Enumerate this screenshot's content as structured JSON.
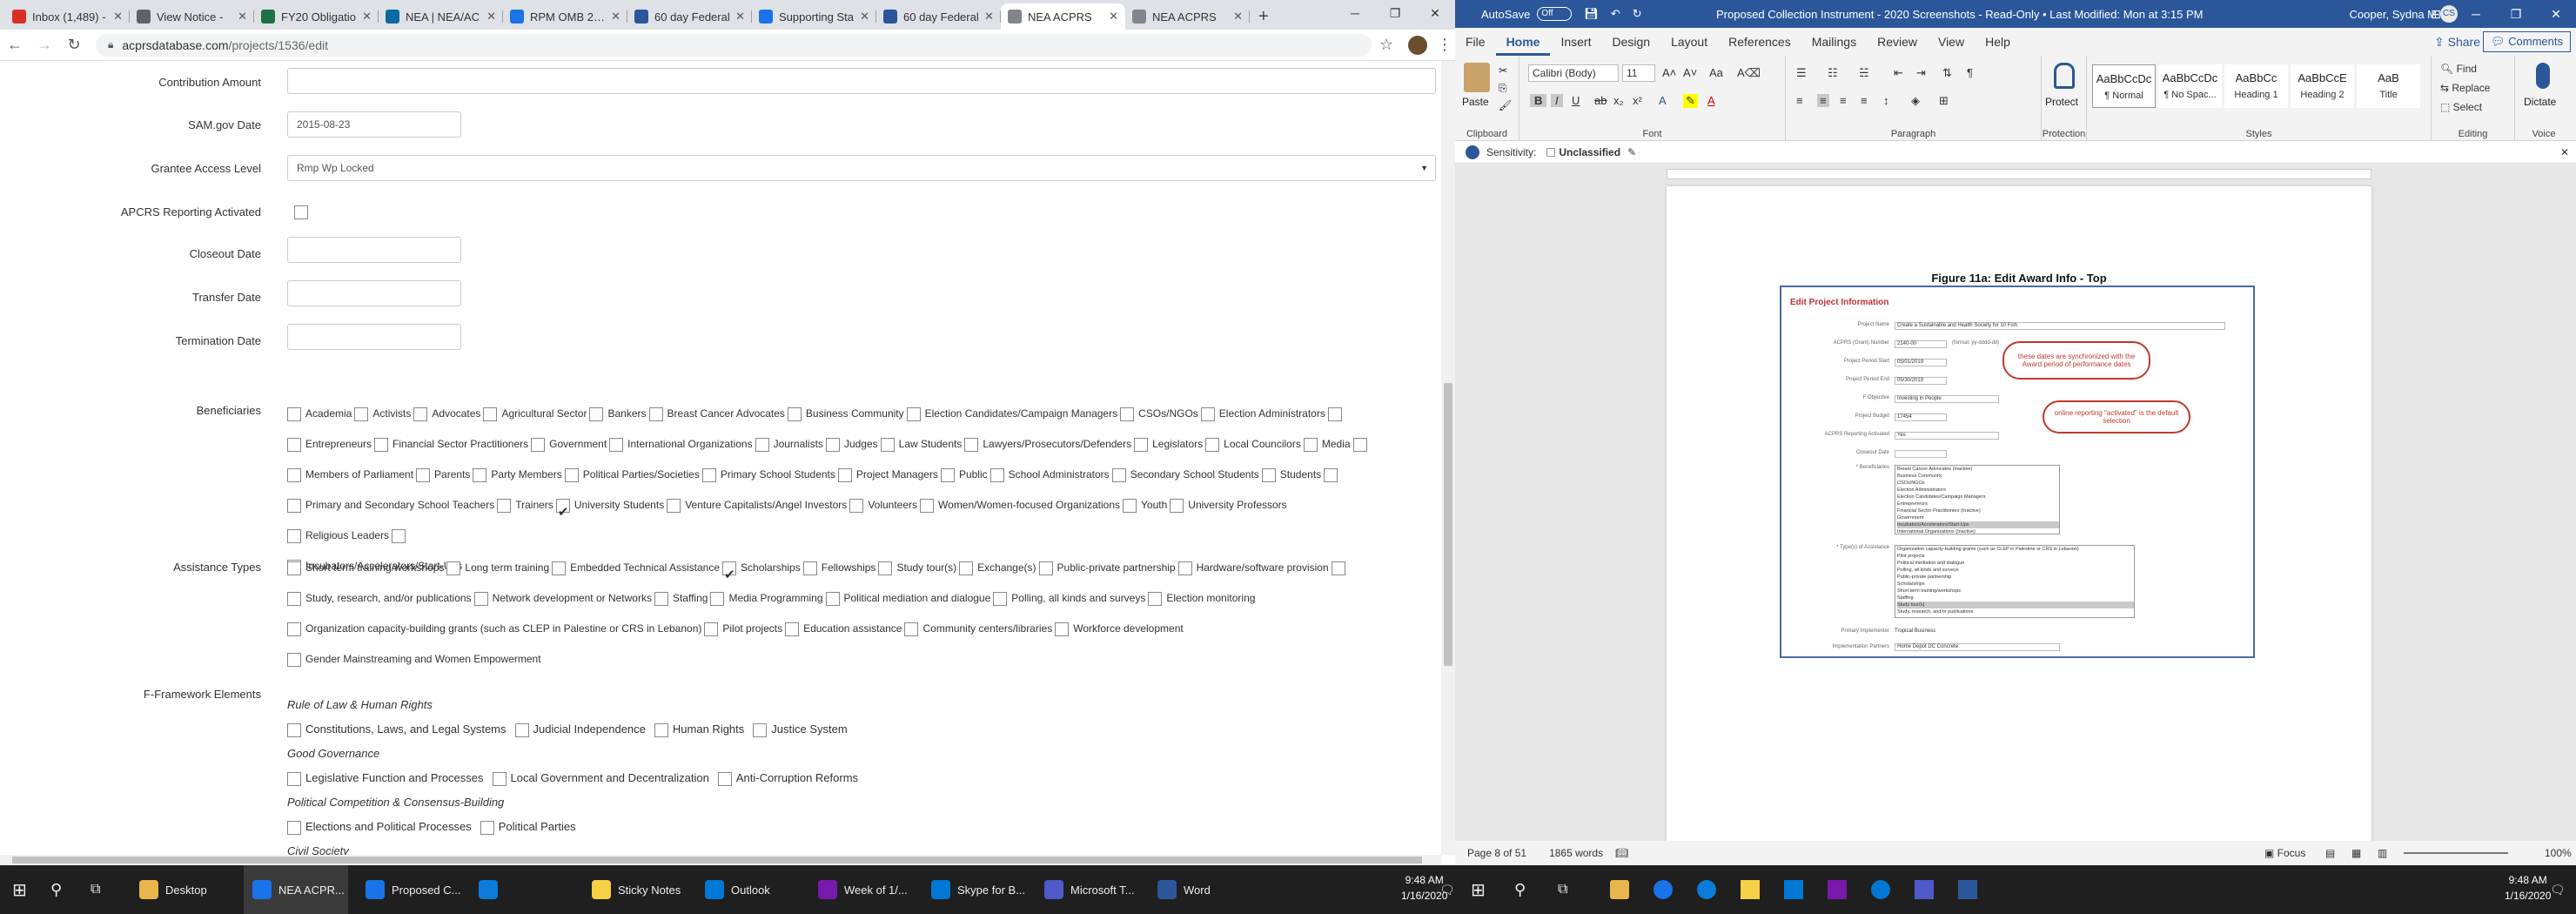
{
  "browser": {
    "tabs": [
      {
        "label": "Inbox (1,489) -",
        "color": "#d93025"
      },
      {
        "label": "View Notice -",
        "color": "#5f6368"
      },
      {
        "label": "FY20 Obligatio",
        "color": "#1e7145"
      },
      {
        "label": "NEA | NEA/AC",
        "color": "#0b6aa2"
      },
      {
        "label": "RPM OMB 2020",
        "color": "#1a73e8"
      },
      {
        "label": "60 day Federal",
        "color": "#2b579a"
      },
      {
        "label": "Supporting Sta",
        "color": "#1a73e8"
      },
      {
        "label": "60 day Federal",
        "color": "#2b579a"
      },
      {
        "label": "NEA ACPRS",
        "color": "#80868b"
      },
      {
        "label": "NEA ACPRS",
        "color": "#80868b"
      }
    ],
    "active_tab": 8,
    "url_host": "acprsdatabase.com",
    "url_path": "/projects/1536/edit",
    "new_tab": "+"
  },
  "form": {
    "contribution_amount_label": "Contribution Amount",
    "sam_label": "SAM.gov Date",
    "sam_value": "2015-08-23",
    "grantee_label": "Grantee Access Level",
    "grantee_value": "Rmp Wp Locked",
    "apcrs_label": "APCRS Reporting Activated",
    "closeout_label": "Closeout Date",
    "transfer_label": "Transfer Date",
    "termination_label": "Termination Date",
    "beneficiaries_label": "Beneficiaries",
    "beneficiaries": [
      [
        "Academia",
        "Activists",
        "Advocates",
        "Agricultural Sector",
        "Bankers",
        "Breast Cancer Advocates",
        "Business Community",
        "Election Candidates/Campaign Managers",
        "CSOs/NGOs",
        "Election Administrators"
      ],
      [
        "Entrepreneurs",
        "Financial Sector Practitioners",
        "Government",
        "International Organizations",
        "Journalists",
        "Judges",
        "Law Students",
        "Lawyers/Prosecutors/Defenders",
        "Legislators",
        "Local Councilors",
        "Media"
      ],
      [
        "Members of Parliament",
        "Parents",
        "Party Members",
        "Political Parties/Societies",
        "Primary School Students",
        "Project Managers",
        "Public",
        "School Administrators",
        "Secondary School Students",
        "Students"
      ],
      [
        "Primary and Secondary School Teachers",
        "Trainers",
        "University Students",
        "Venture Capitalists/Angel Investors",
        "Volunteers",
        "Women/Women-focused Organizations",
        "Youth",
        "University Professors",
        "Religious Leaders"
      ],
      [
        "Incubators/Accelerators/Start-Ups"
      ]
    ],
    "assistance_label": "Assistance Types",
    "assistance": [
      [
        "Short term training/workshops",
        "Long term training",
        "Embedded Technical Assistance",
        "Scholarships",
        "Fellowships",
        "Study tour(s)",
        "Exchange(s)",
        "Public-private partnership",
        "Hardware/software provision"
      ],
      [
        "Study, research, and/or publications",
        "Network development or Networks",
        "Staffing",
        "Media Programming",
        "Political mediation and dialogue",
        "Polling, all kinds and surveys",
        "Election monitoring"
      ],
      [
        "Organization capacity-building grants (such as CLEP in Palestine or CRS in Lebanon)",
        "Pilot projects",
        "Education assistance",
        "Community centers/libraries",
        "Workforce development"
      ],
      [
        "Gender Mainstreaming and Women Empowerment"
      ]
    ],
    "framework_label": "F-Framework Elements",
    "framework": [
      {
        "cat": "Rule of Law & Human Rights",
        "items": [
          "Constitutions, Laws, and Legal Systems",
          "Judicial Independence",
          "Human Rights",
          "Justice System"
        ]
      },
      {
        "cat": "Good Governance",
        "items": [
          "Legislative Function and Processes",
          "Local Government and Decentralization",
          "Anti-Corruption Reforms"
        ]
      },
      {
        "cat": "Political Competition & Consensus-Building",
        "items": [
          "Elections and Political Processes",
          "Political Parties"
        ]
      },
      {
        "cat": "Civil Society",
        "items": []
      }
    ]
  },
  "word": {
    "autosave": "AutoSave",
    "autosave_state": "Off",
    "title": "Proposed Collection Instrument - 2020 Screenshots  -  Read-Only  •  Last Modified: Mon at 3:15 PM",
    "user": "Cooper, Sydna M",
    "user_initials": "CS",
    "menu": [
      "File",
      "Home",
      "Insert",
      "Design",
      "Layout",
      "References",
      "Mailings",
      "Review",
      "View",
      "Help"
    ],
    "share": "Share",
    "comments": "Comments",
    "paste": "Paste",
    "font_name": "Calibri (Body)",
    "font_size": "11",
    "protect": "Protect",
    "dictate": "Dictate",
    "group_labels": [
      "Clipboard",
      "Font",
      "Paragraph",
      "Protection",
      "Styles",
      "Editing",
      "Voice"
    ],
    "styles": [
      {
        "preview": "AaBbCcDc",
        "name": "¶ Normal"
      },
      {
        "preview": "AaBbCcDc",
        "name": "¶ No Spac..."
      },
      {
        "preview": "AaBbCc",
        "name": "Heading 1"
      },
      {
        "preview": "AaBbCcE",
        "name": "Heading 2"
      },
      {
        "preview": "AaB",
        "name": "Title"
      }
    ],
    "editing": [
      "Find",
      "Replace",
      "Select"
    ],
    "sensitivity_label": "Sensitivity:",
    "sensitivity_value": "Unclassified",
    "figure_caption": "Figure 11a: Edit Award Info - Top",
    "shot": {
      "header": "Edit Project Information",
      "rows": [
        {
          "label": "Project Name",
          "value": "Create a Sustainable and Health Society for 10 Fish"
        },
        {
          "label": "ACPRS (Grant) Number",
          "value": "2140-00"
        },
        {
          "label": "Project Period Start",
          "value": "05/01/2019"
        },
        {
          "label": "Project Period End",
          "value": "05/30/2019"
        },
        {
          "label": "F Objective",
          "value": "Investing in People"
        },
        {
          "label": "Project Budget",
          "value": "17454"
        },
        {
          "label": "ACPRS Reporting Activated",
          "value": "Yes"
        },
        {
          "label": "Closeout Date",
          "value": ""
        }
      ],
      "format_hint": "(format: yy-dddd-dd)",
      "beneficiaries_label": "* Beneficiaries",
      "beneficiaries": [
        "Breast Cancer Advocates (Inactive)",
        "Business Community",
        "CSOs/NGOs",
        "Election Administrators",
        "Election Candidates/Campaign Managers",
        "Entrepreneurs",
        "Financial Sector Practitioners (Inactive)",
        "Government",
        "Incubators/Accelerators/Start-Ups",
        "International Organizations (Inactive)"
      ],
      "assistance_label": "* Type(s) of Assistance",
      "assistance": [
        "Organization capacity-building grants (such as CLEP in Palestine or CRS in Lebanon)",
        "Pilot projects",
        "Political mediation and dialogue",
        "Polling, all kinds and surveys",
        "Public-private partnership",
        "Scholarships",
        "Short term training/workshops",
        "Staffing",
        "Study tour(s)",
        "Study, research, and/or publications"
      ],
      "implementer_label": "Primary Implementer",
      "implementer_value": "Tropical Business",
      "partners_label": "Implementation Partners",
      "partners_value": "Home Depot DC Concrete",
      "callout1": "these dates are synchronized with the Award period of performance dates",
      "callout2": "online reporting \"activated\" is the default selection"
    },
    "status": {
      "page": "Page 8 of 51",
      "words": "1865 words",
      "focus": "Focus",
      "zoom": "100%"
    }
  },
  "taskbar": {
    "apps": [
      {
        "label": "Desktop",
        "color": "#e8b64c"
      },
      {
        "label": "NEA ACPR...",
        "color": "#1a73e8"
      },
      {
        "label": "Proposed C...",
        "color": "#1a73e8"
      },
      {
        "label": "",
        "color": "#0a7bd8"
      },
      {
        "label": "Sticky Notes",
        "color": "#f7d046"
      },
      {
        "label": "Outlook",
        "color": "#0078d4"
      },
      {
        "label": "Week of 1/...",
        "color": "#7719aa"
      },
      {
        "label": "Skype for B...",
        "color": "#0078d4"
      },
      {
        "label": "Microsoft T...",
        "color": "#5059c9"
      },
      {
        "label": "Word",
        "color": "#2b579a"
      }
    ],
    "time_left": "9:48 AM",
    "date_left": "1/16/2020",
    "time_right": "9:48 AM",
    "date_right": "1/16/2020"
  }
}
